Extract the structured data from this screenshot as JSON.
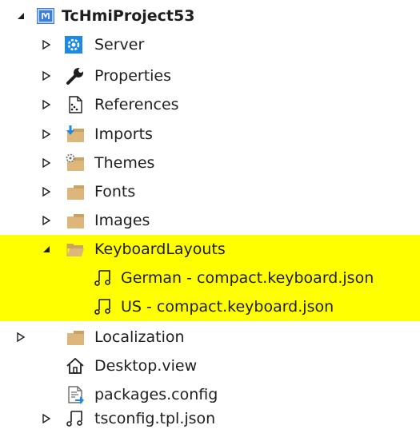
{
  "tree": {
    "project": {
      "label": "TcHmiProject53",
      "expanded": true
    },
    "items": [
      {
        "key": "server",
        "label": "Server",
        "icon": "server-settings-icon",
        "expandable": true,
        "expanded": false
      },
      {
        "key": "properties",
        "label": "Properties",
        "icon": "wrench-icon",
        "expandable": true,
        "expanded": false
      },
      {
        "key": "references",
        "label": "References",
        "icon": "references-icon",
        "expandable": true,
        "expanded": false
      },
      {
        "key": "imports",
        "label": "Imports",
        "icon": "imports-folder-icon",
        "expandable": true,
        "expanded": false
      },
      {
        "key": "themes",
        "label": "Themes",
        "icon": "themes-folder-icon",
        "expandable": true,
        "expanded": false
      },
      {
        "key": "fonts",
        "label": "Fonts",
        "icon": "folder-icon",
        "expandable": true,
        "expanded": false
      },
      {
        "key": "images",
        "label": "Images",
        "icon": "folder-icon",
        "expandable": true,
        "expanded": false
      },
      {
        "key": "keyboardlayouts",
        "label": "KeyboardLayouts",
        "icon": "folder-open-icon",
        "expandable": true,
        "expanded": true,
        "highlighted": true
      },
      {
        "key": "german",
        "label": "German - compact.keyboard.json",
        "icon": "json-file-icon",
        "expandable": false,
        "highlighted": true
      },
      {
        "key": "us",
        "label": "US - compact.keyboard.json",
        "icon": "json-file-icon",
        "expandable": false,
        "highlighted": true
      },
      {
        "key": "localization",
        "label": "Localization",
        "icon": "folder-icon",
        "expandable": true,
        "expanded": false
      },
      {
        "key": "desktop",
        "label": "Desktop.view",
        "icon": "home-icon",
        "expandable": false
      },
      {
        "key": "packages",
        "label": "packages.config",
        "icon": "config-file-icon",
        "expandable": false
      },
      {
        "key": "tsconfig",
        "label": "tsconfig.tpl.json",
        "icon": "json-file-icon",
        "expandable": true,
        "expanded": false
      }
    ]
  },
  "colors": {
    "highlight": "#ffff00",
    "folder": "#dcb67a",
    "accent_blue": "#1e88e5"
  }
}
